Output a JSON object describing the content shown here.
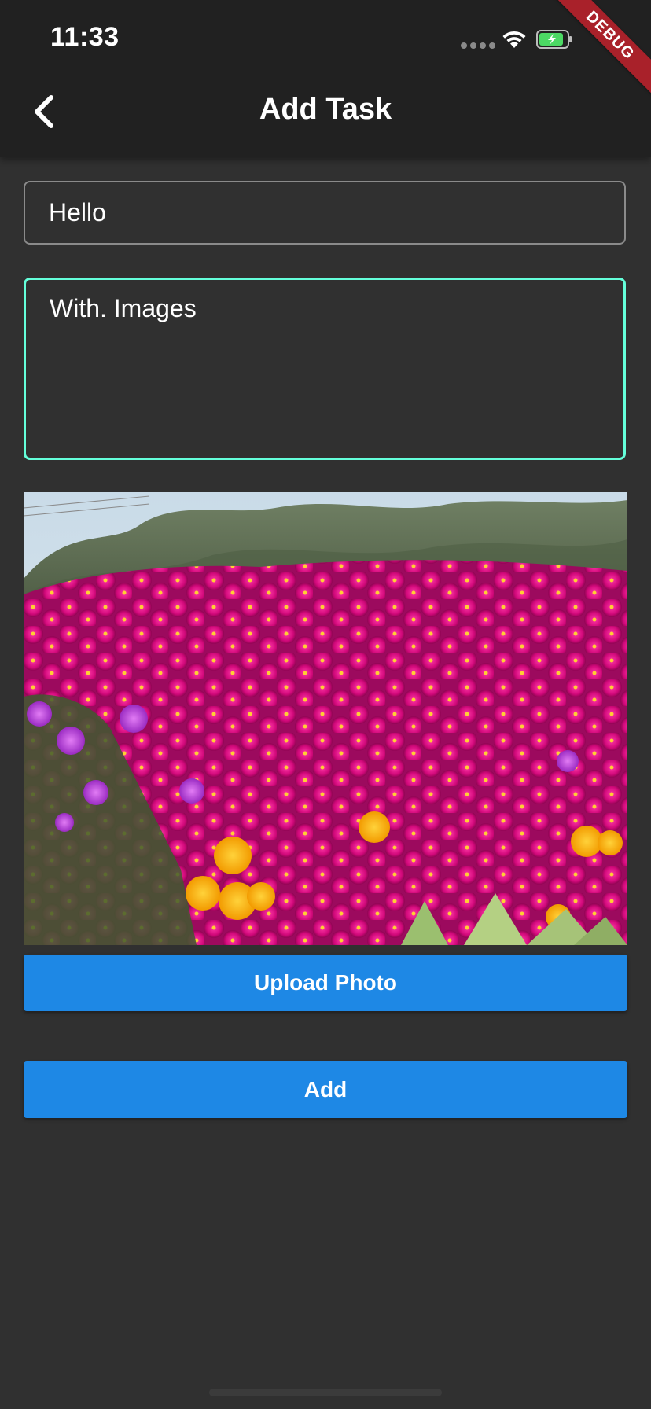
{
  "status_bar": {
    "time": "11:33"
  },
  "debug_banner": {
    "label": "DEBUG"
  },
  "app_bar": {
    "title": "Add Task",
    "back_icon": "chevron-left-icon"
  },
  "form": {
    "title_value": "Hello",
    "description_value": "With. Images"
  },
  "photo": {
    "subject": "flower field"
  },
  "buttons": {
    "upload_label": "Upload Photo",
    "add_label": "Add"
  },
  "colors": {
    "app_bar": "#212121",
    "background": "#303030",
    "accent": "#64ffda",
    "button": "#1e88e5",
    "debug": "#a9212a"
  }
}
